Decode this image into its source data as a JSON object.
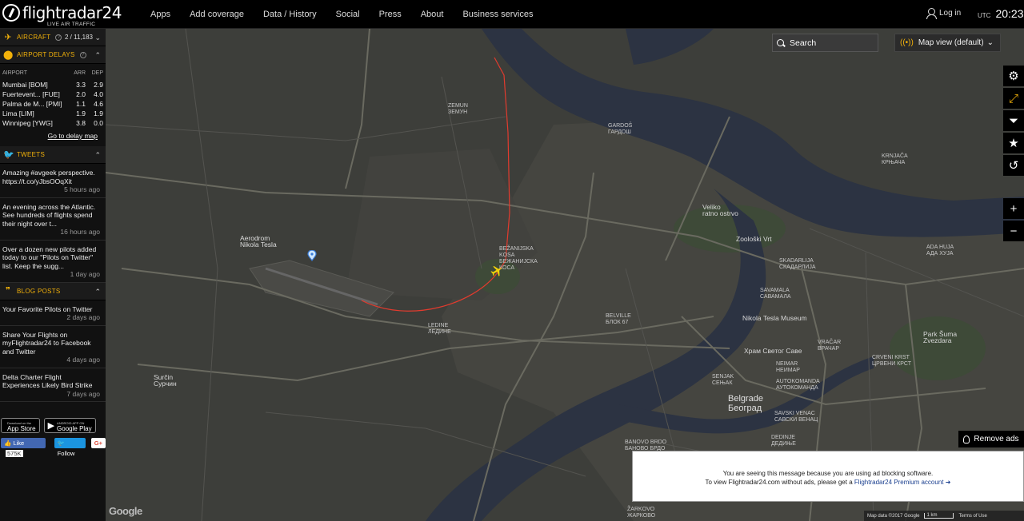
{
  "header": {
    "brand": "flightradar24",
    "tagline": "LIVE AIR TRAFFIC",
    "nav": [
      "Apps",
      "Add coverage",
      "Data / History",
      "Social",
      "Press",
      "About",
      "Business services"
    ],
    "login_label": "Log in",
    "timezone": "UTC",
    "time": "20:23"
  },
  "sidebar": {
    "aircraft": {
      "title": "AIRCRAFT",
      "count": "2 / 11,183"
    },
    "delays": {
      "title": "AIRPORT DELAYS",
      "columns": [
        "AIRPORT",
        "ARR",
        "DEP"
      ],
      "rows": [
        {
          "airport": "Mumbai [BOM]",
          "arr": "3.3",
          "dep": "2.9"
        },
        {
          "airport": "Fuertevent... [FUE]",
          "arr": "2.0",
          "dep": "4.0"
        },
        {
          "airport": "Palma de M... [PMI]",
          "arr": "1.1",
          "dep": "4.6"
        },
        {
          "airport": "Lima [LIM]",
          "arr": "1.9",
          "dep": "1.9"
        },
        {
          "airport": "Winnipeg [YWG]",
          "arr": "3.8",
          "dep": "0.0"
        }
      ],
      "link": "Go to delay map"
    },
    "tweets": {
      "title": "TWEETS",
      "items": [
        {
          "text": "Amazing #avgeek perspective. https://t.co/yJbsOOqXit",
          "ago": "5 hours ago"
        },
        {
          "text": "An evening across the Atlantic. See hundreds of flights spend their night over t...",
          "ago": "16 hours ago"
        },
        {
          "text": "Over a dozen new pilots added today to our \"Pilots on Twitter\" list. Keep the sugg...",
          "ago": "1 day ago"
        }
      ]
    },
    "blog": {
      "title": "BLOG POSTS",
      "items": [
        {
          "text": "Your Favorite Pilots on Twitter",
          "ago": "2 days ago"
        },
        {
          "text": "Share Your Flights on myFlightradar24 to Facebook and Twitter",
          "ago": "4 days ago"
        },
        {
          "text": "Delta Charter Flight Experiences Likely Bird Strike",
          "ago": "7 days ago"
        }
      ]
    },
    "stores": {
      "appstore_small": "Download on the",
      "appstore_big": "App Store",
      "google_small": "ANDROID APP ON",
      "google_big": "Google Play"
    },
    "social": {
      "like": "Like",
      "like_count": "575K",
      "follow": "Follow",
      "gplus": "G+"
    }
  },
  "map": {
    "search_placeholder": "Search",
    "map_view_label": "Map view (default)",
    "remove_ads": "Remove ads",
    "adblock_line1": "You are seeing this message because you are using ad blocking software.",
    "adblock_line2_prefix": "To view Flightradar24.com without ads, please get a",
    "adblock_link": "Flightradar24 Premium account",
    "attribution": {
      "data": "Map data ©2017 Google",
      "scale": "1 km",
      "terms": "Terms of Use"
    },
    "google": "Google",
    "labels": {
      "aerodrom": "Aerodrom\nNikola Tesla",
      "zemun": "ZEMUN\nЗЕМУН",
      "gardos": "GARDOŠ\nГАРДОШ",
      "krnjaca": "KRNJAČA\nКРЊАЧА",
      "veliko": "Veliko\nratno ostrvo",
      "zooloski": "Zoološki Vrt",
      "ada_huja": "ADA HUJA\nАДА ХУЈА",
      "skadarlija": "SKADARLIJA\nСКАДАРЛИЈА",
      "savamala": "SAVAMALA\nСАВАМАЛА",
      "bezanijska": "BEŽANIJSKA\nKOSA\nБЕЖАНИЈСКА\nКОСА",
      "belville": "BELVILLE\nБЛОК 67",
      "ledine": "LEDINE\nЛЕДИНЕ",
      "tesla_museum": "Nikola Tesla Museum",
      "hram": "Храм Светог Саве",
      "vracar": "VRAČAR\nВРАЧАР",
      "crveni_krst": "CRVENI KRST\nЦРВЕНИ КРСТ",
      "senjak": "SENJAK\nСЕЊАК",
      "neimar": "NEIMAR\nНЕИМАР",
      "autokomanda": "AUTOKOMANDA\nАУТОКОМАНДА",
      "belgrade": "Belgrade\nБеоград",
      "savski": "SAVSKI VENAC\nСАВСКИ ВЕНАЦ",
      "park_suma": "Park Šuma\nZvezdara",
      "surcin": "Surčin\nСурчин",
      "banovo": "BANOVO BRDO\nБАНОВО БРДО",
      "zarkovo": "ŽARKOVO\nЖАРКОВО",
      "dedinje": "DEDINJE\nДЕДИЊЕ"
    }
  }
}
